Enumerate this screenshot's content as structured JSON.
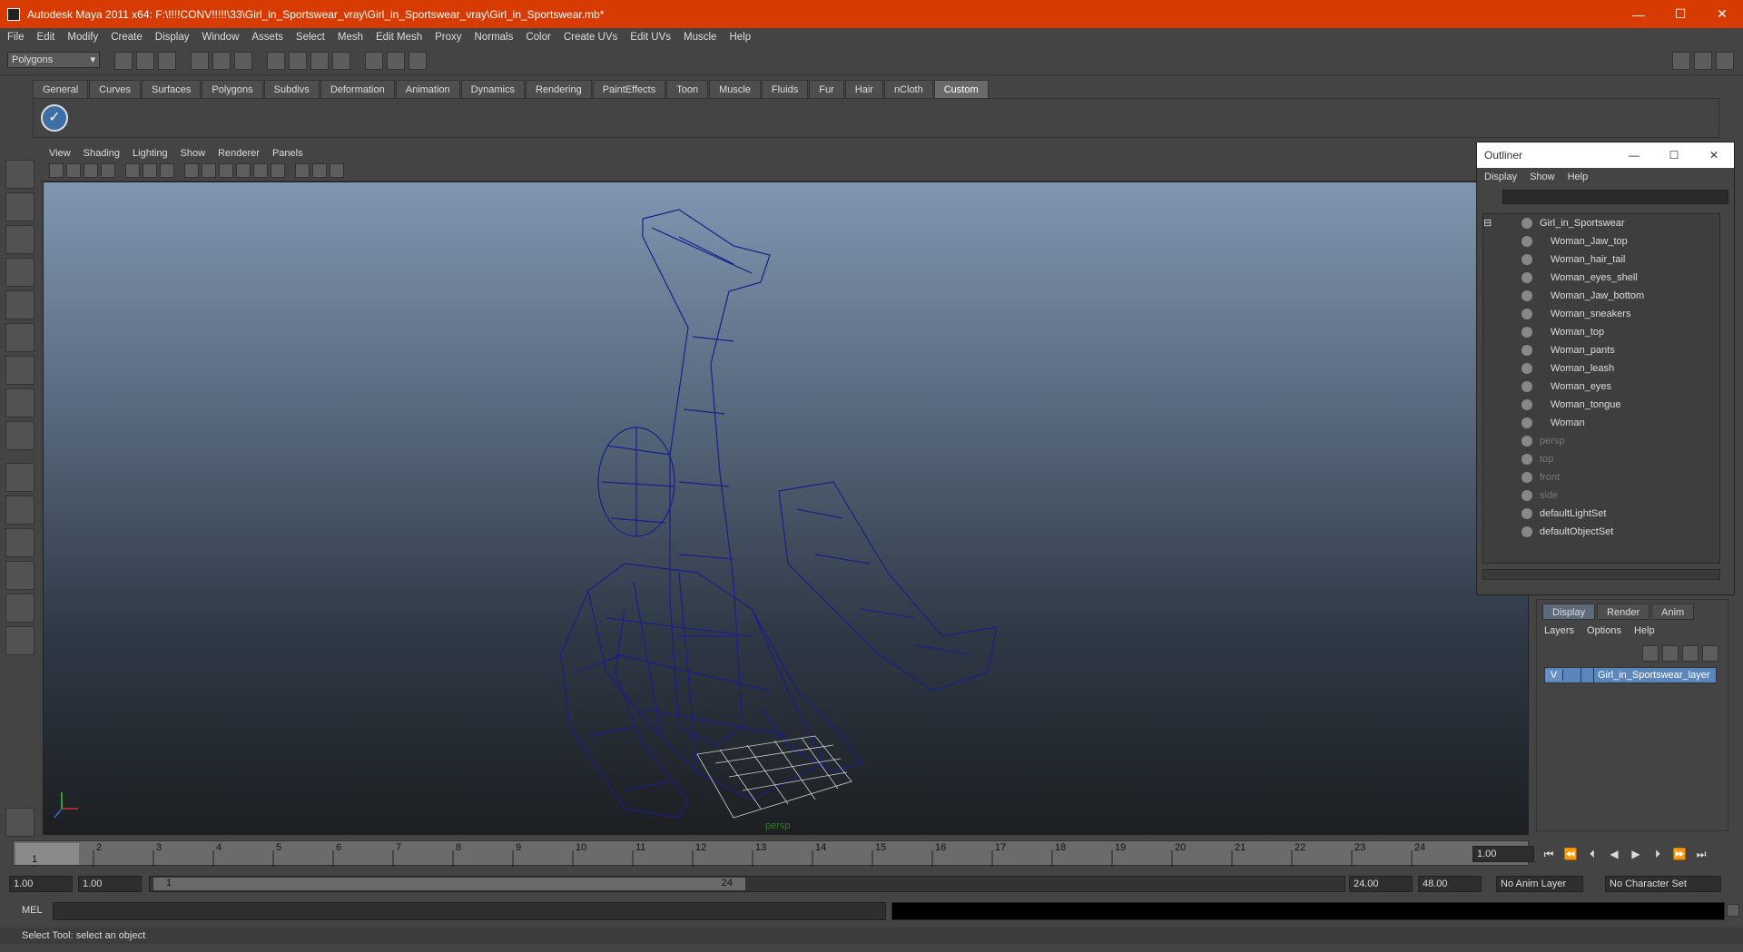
{
  "titlebar": {
    "title": "Autodesk Maya 2011 x64: F:\\!!!!CONV!!!!!\\33\\Girl_in_Sportswear_vray\\Girl_in_Sportswear_vray\\Girl_in_Sportswear.mb*",
    "minimize": "—",
    "maximize": "☐",
    "close": "✕"
  },
  "menubar": [
    "File",
    "Edit",
    "Modify",
    "Create",
    "Display",
    "Window",
    "Assets",
    "Select",
    "Mesh",
    "Edit Mesh",
    "Proxy",
    "Normals",
    "Color",
    "Create UVs",
    "Edit UVs",
    "Muscle",
    "Help"
  ],
  "mode_select": "Polygons",
  "shelf_tabs": [
    "General",
    "Curves",
    "Surfaces",
    "Polygons",
    "Subdivs",
    "Deformation",
    "Animation",
    "Dynamics",
    "Rendering",
    "PaintEffects",
    "Toon",
    "Muscle",
    "Fluids",
    "Fur",
    "Hair",
    "nCloth",
    "Custom"
  ],
  "shelf_active_tab": "Custom",
  "viewport": {
    "menu": [
      "View",
      "Shading",
      "Lighting",
      "Show",
      "Renderer",
      "Panels"
    ],
    "camera_label": "persp",
    "wire_color": "#1a1f8a"
  },
  "outliner": {
    "title": "Outliner",
    "menu": [
      "Display",
      "Show",
      "Help"
    ],
    "root": "Girl_in_Sportswear",
    "children": [
      "Woman_Jaw_top",
      "Woman_hair_tail",
      "Woman_eyes_shell",
      "Woman_Jaw_bottom",
      "Woman_sneakers",
      "Woman_top",
      "Woman_pants",
      "Woman_leash",
      "Woman_eyes",
      "Woman_tongue",
      "Woman"
    ],
    "cameras": [
      "persp",
      "top",
      "front",
      "side"
    ],
    "sets": [
      "defaultLightSet",
      "defaultObjectSet"
    ]
  },
  "layers": {
    "tabs": [
      "Display",
      "Render",
      "Anim"
    ],
    "active_tab": "Display",
    "menu": [
      "Layers",
      "Options",
      "Help"
    ],
    "layer_visible": "V",
    "layer_name": "Girl_in_Sportswear_layer"
  },
  "timeslider": {
    "ticks": [
      "1",
      "2",
      "3",
      "4",
      "5",
      "6",
      "7",
      "8",
      "9",
      "10",
      "11",
      "12",
      "13",
      "14",
      "15",
      "16",
      "17",
      "18",
      "19",
      "20",
      "21",
      "22",
      "23",
      "24"
    ],
    "current_frame": "1",
    "current_time_field": "1.00"
  },
  "range": {
    "start_field": "1.00",
    "playback_start": "1.00",
    "range_start_label": "1",
    "range_end_label": "24",
    "playback_end": "24.00",
    "end_field": "48.00",
    "anim_layer": "No Anim Layer",
    "character_set": "No Character Set"
  },
  "cmdline": {
    "label": "MEL"
  },
  "helpline": {
    "text": "Select Tool: select an object"
  }
}
